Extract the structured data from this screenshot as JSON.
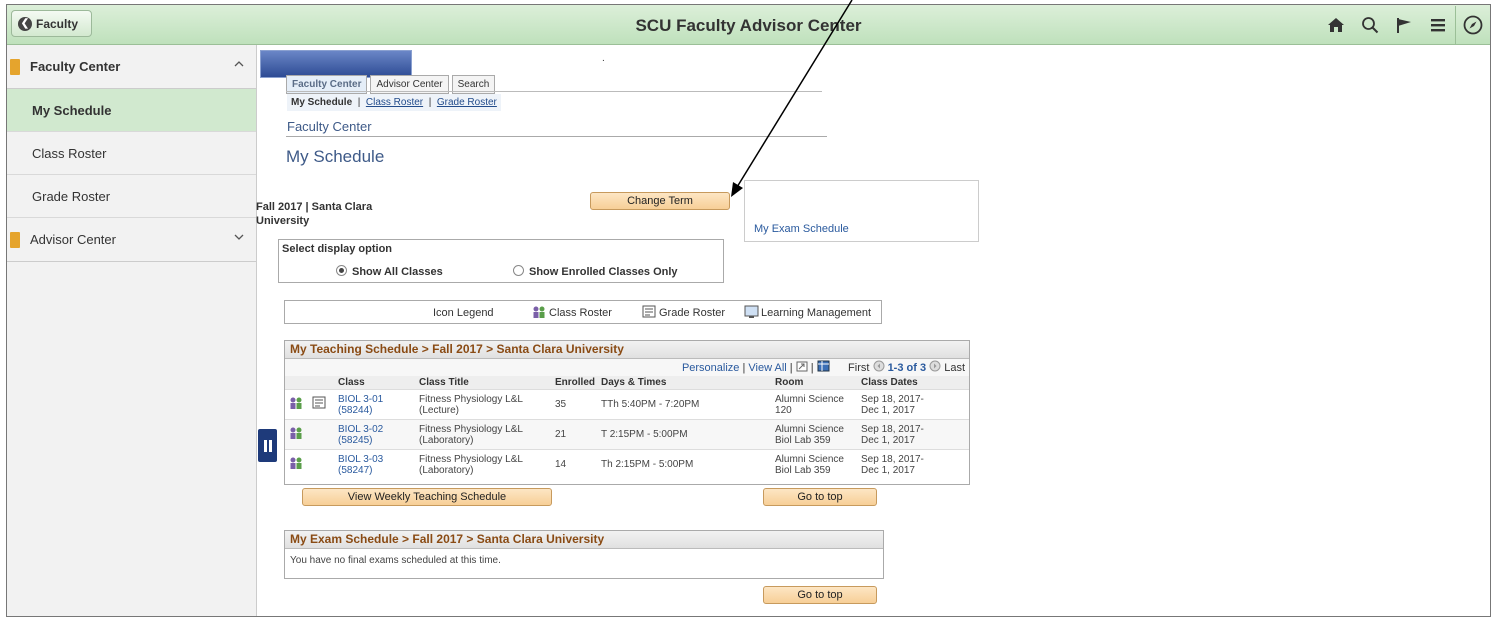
{
  "banner": {
    "back_label": "Faculty",
    "title": "SCU Faculty Advisor Center",
    "icons": [
      "home-icon",
      "search-icon",
      "flag-icon",
      "menu-icon",
      "compass-icon"
    ]
  },
  "sidebar": {
    "group1": "Faculty Center",
    "items": [
      {
        "label": "My Schedule"
      },
      {
        "label": "Class Roster"
      },
      {
        "label": "Grade Roster"
      }
    ],
    "group2": "Advisor Center"
  },
  "tabs": [
    "Faculty Center",
    "Advisor Center",
    "Search"
  ],
  "subnav": {
    "current": "My Schedule",
    "sep": "|",
    "link1": "Class Roster",
    "link2": "Grade Roster"
  },
  "section_label": "Faculty Center",
  "page_title": "My Schedule",
  "dot": ".",
  "term": {
    "line1": "Fall 2017 | Santa Clara",
    "line2": "University"
  },
  "change_term_label": "Change Term",
  "exam_schedule_link": "My Exam Schedule",
  "display_option": {
    "label": "Select display option",
    "option1": "Show All Classes",
    "option2": "Show Enrolled Classes Only",
    "selected": "Show All Classes"
  },
  "legend": {
    "title": "Icon Legend",
    "class_roster": "Class Roster",
    "grade_roster": "Grade Roster",
    "learning_mgmt": "Learning Management"
  },
  "teaching": {
    "title": "My Teaching Schedule > Fall 2017 > Santa Clara University",
    "personalize": "Personalize",
    "view_all": "View All",
    "first": "First",
    "range": "1-3 of 3",
    "last": "Last",
    "columns": [
      "Class",
      "Class Title",
      "Enrolled",
      "Days & Times",
      "Room",
      "Class Dates"
    ],
    "rows": [
      {
        "class": "BIOL 3-01",
        "num": "(58244)",
        "title1": "Fitness Physiology L&L",
        "title2": "(Lecture)",
        "enrolled": "35",
        "days": "TTh 5:40PM - 7:20PM",
        "room1": "Alumni Science",
        "room2": "120",
        "dates1": "Sep 18, 2017-",
        "dates2": "Dec 1, 2017",
        "grade_icon": true
      },
      {
        "class": "BIOL 3-02",
        "num": "(58245)",
        "title1": "Fitness Physiology L&L",
        "title2": "(Laboratory)",
        "enrolled": "21",
        "days": "T 2:15PM - 5:00PM",
        "room1": "Alumni Science",
        "room2": "Biol Lab 359",
        "dates1": "Sep 18, 2017-",
        "dates2": "Dec 1, 2017",
        "grade_icon": false
      },
      {
        "class": "BIOL 3-03",
        "num": "(58247)",
        "title1": "Fitness Physiology L&L",
        "title2": "(Laboratory)",
        "enrolled": "14",
        "days": "Th 2:15PM - 5:00PM",
        "room1": "Alumni Science",
        "room2": "Biol Lab 359",
        "dates1": "Sep 18, 2017-",
        "dates2": "Dec 1, 2017",
        "grade_icon": false
      }
    ]
  },
  "view_weekly_label": "View Weekly Teaching Schedule",
  "go_to_top_label": "Go to top",
  "exam": {
    "title": "My Exam Schedule > Fall 2017 > Santa Clara University",
    "message": "You have no final exams scheduled at this time."
  }
}
